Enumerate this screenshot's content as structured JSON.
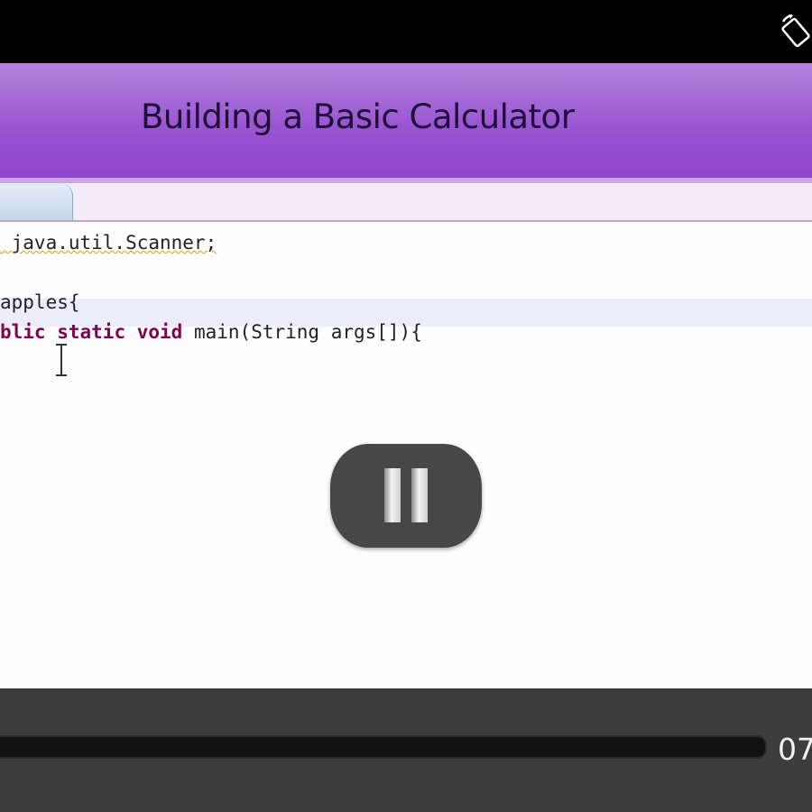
{
  "title": "Building a Basic Calculator",
  "editor": {
    "tab_close_icon": "close-icon",
    "lines": {
      "import_rest": " java.util.Scanner;",
      "class_rest": "apples{",
      "main_kw1": "blic",
      "main_kw2": "static",
      "main_kw3": "void",
      "main_rest": "main(String args[]){"
    }
  },
  "player": {
    "state_icon": "pause-icon",
    "time": "07"
  },
  "status_bar": {
    "icon": "screen-rotate-icon"
  },
  "colors": {
    "title_bar": "#9a55d2",
    "keyword": "#7f0055",
    "controls": "#3d3d3d"
  }
}
